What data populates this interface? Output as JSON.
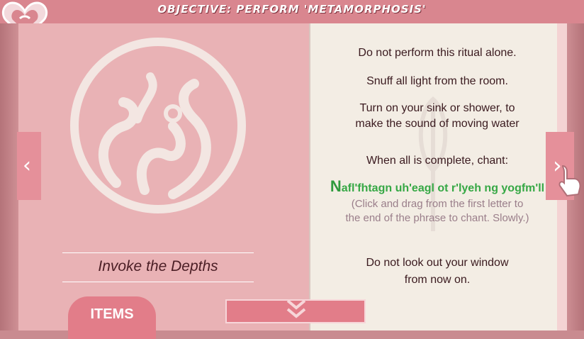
{
  "header": {
    "objective": "OBJECTIVE: PERFORM 'METAMORPHOSIS'"
  },
  "page_left": {
    "title": "Invoke the Depths",
    "items_tab": "ITEMS"
  },
  "page_right": {
    "lines": [
      "Do not perform this ritual alone.",
      "Snuff all light from the room.",
      "Turn on your sink or shower, to",
      "make the sound of moving water",
      "When all is complete, chant:"
    ],
    "chant_first_letter": "N",
    "chant_rest": "afl'fhtagn uh'eagl ot r'lyeh ng yogfm'll",
    "hint_line1": "(Click and drag from the first letter to",
    "hint_line2": "the end of the phrase to chant. Slowly.)",
    "warning_line1": "Do not look out your window",
    "warning_line2": "from now on."
  },
  "icons": {
    "prev": "chevron-left-icon",
    "next": "chevron-right-icon",
    "down": "double-chevron-down-icon"
  },
  "colors": {
    "accent": "#e27d89",
    "chant_green": "#36a845"
  }
}
